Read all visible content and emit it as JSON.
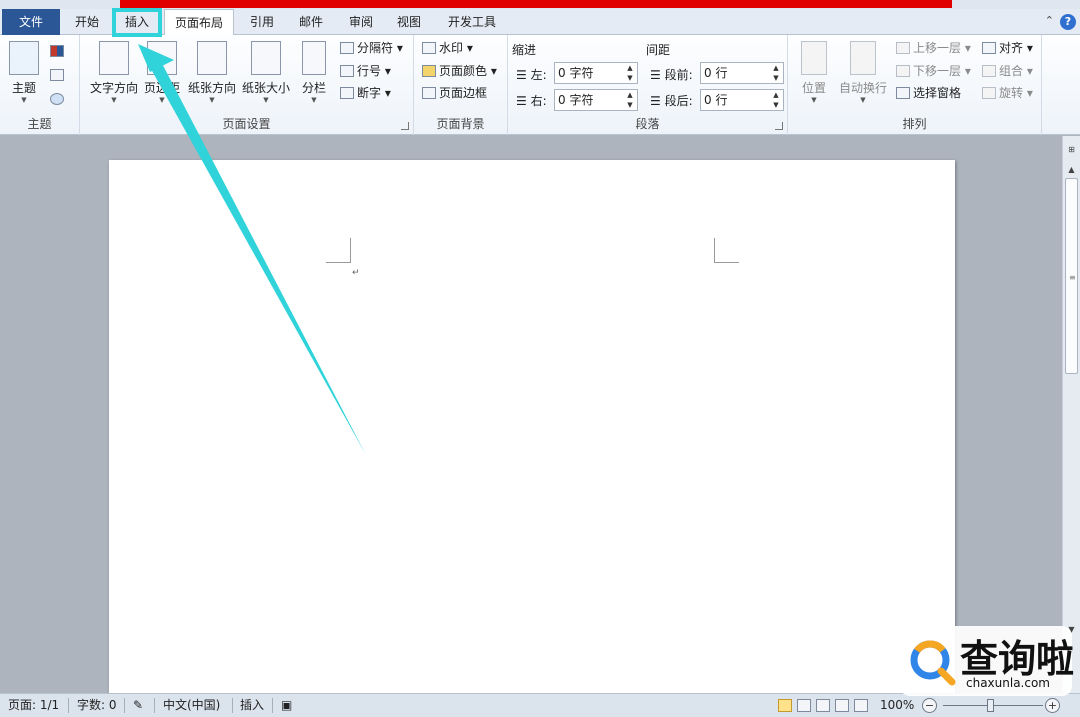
{
  "tabs": {
    "file": "文件",
    "home": "开始",
    "insert": "插入",
    "page_layout": "页面布局",
    "references": "引用",
    "mailings": "邮件",
    "review": "审阅",
    "view": "视图",
    "developer": "开发工具"
  },
  "ribbon": {
    "themes": {
      "themes_btn": "主题",
      "group_label": "主题"
    },
    "page_setup": {
      "text_direction": "文字方向",
      "margins": "页边距",
      "orientation": "纸张方向",
      "size": "纸张大小",
      "columns": "分栏",
      "breaks": "分隔符",
      "line_numbers": "行号",
      "hyphenation": "断字",
      "group_label": "页面设置"
    },
    "page_background": {
      "watermark": "水印",
      "page_color": "页面颜色",
      "page_borders": "页面边框",
      "group_label": "页面背景"
    },
    "paragraph": {
      "indent_title": "缩进",
      "spacing_title": "间距",
      "left_label": "左:",
      "right_label": "右:",
      "before_label": "段前:",
      "after_label": "段后:",
      "indent_left_value": "0 字符",
      "indent_right_value": "0 字符",
      "spacing_before_value": "0 行",
      "spacing_after_value": "0 行",
      "group_label": "段落"
    },
    "arrange": {
      "position": "位置",
      "wrap_text": "自动换行",
      "bring_forward": "上移一层",
      "send_backward": "下移一层",
      "selection_pane": "选择窗格",
      "align": "对齐",
      "group": "组合",
      "rotate": "旋转",
      "group_label": "排列"
    }
  },
  "status": {
    "page": "页面: 1/1",
    "words": "字数: 0",
    "language": "中文(中国)",
    "mode": "插入",
    "zoom": "100%",
    "zoom_minus": "−",
    "zoom_plus": "+"
  },
  "watermark": {
    "title": "查询啦",
    "site": "chaxunla.com"
  },
  "colors": {
    "highlight": "#2fd3d9",
    "file_tab": "#2b5797",
    "red_bar": "#e00000"
  }
}
